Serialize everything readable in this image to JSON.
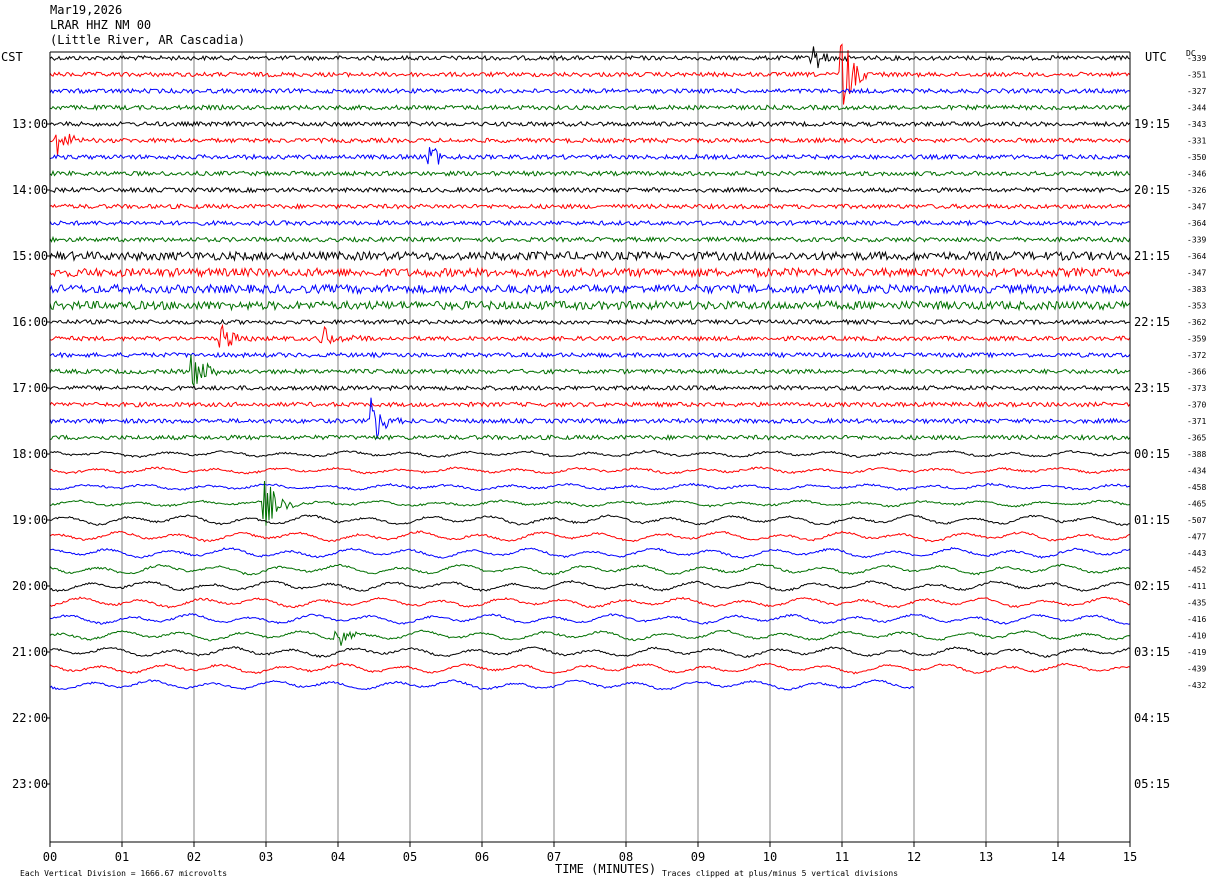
{
  "header": {
    "line1": "Mar19,2026",
    "line2": "LRAR HHZ NM 00",
    "line3": "(Little River, AR Cascadia)"
  },
  "labels": {
    "left_tz": "CST",
    "right_tz": "UTC",
    "dc": "DC",
    "xlabel": "TIME (MINUTES)",
    "footer_left": "Each Vertical Division = 1666.67 microvolts",
    "footer_right": "Traces clipped at plus/minus 5 vertical divisions"
  },
  "chart_data": {
    "type": "line",
    "title": "LRAR HHZ NM 00",
    "xlabel": "TIME (MINUTES)",
    "xlim": [
      0,
      15
    ],
    "x_ticks": [
      "00",
      "01",
      "02",
      "03",
      "04",
      "05",
      "06",
      "07",
      "08",
      "09",
      "10",
      "11",
      "12",
      "13",
      "14",
      "15"
    ],
    "left_hour_labels": [
      "13:00",
      "14:00",
      "15:00",
      "16:00",
      "17:00",
      "18:00",
      "19:00",
      "20:00",
      "21:00",
      "22:00",
      "23:00"
    ],
    "right_hour_labels": [
      "19:15",
      "20:15",
      "21:15",
      "22:15",
      "23:15",
      "00:15",
      "01:15",
      "02:15",
      "03:15",
      "04:15",
      "05:15"
    ],
    "trace_colors": [
      "#000000",
      "#ff0000",
      "#0000ff",
      "#007000"
    ],
    "dc_offsets": [
      -339,
      -351,
      -327,
      -344,
      -343,
      -331,
      -350,
      -346,
      -326,
      -347,
      -364,
      -339,
      -364,
      -347,
      -383,
      -353,
      -362,
      -359,
      -372,
      -366,
      -373,
      -370,
      -371,
      -365,
      -388,
      -434,
      -458,
      -465,
      -507,
      -477,
      -443,
      -452,
      -411,
      -435,
      -416,
      -410,
      -419,
      -439,
      -432
    ],
    "trace_count": 39,
    "last_trace_end_minute": 12,
    "events": [
      {
        "trace": 1,
        "minute": 11.0,
        "amp": 5
      },
      {
        "trace": 0,
        "minute": 10.6,
        "amp": 2
      },
      {
        "trace": 5,
        "minute": 0.1,
        "amp": 2
      },
      {
        "trace": 6,
        "minute": 5.3,
        "amp": 1.5
      },
      {
        "trace": 17,
        "minute": 2.4,
        "amp": 2
      },
      {
        "trace": 17,
        "minute": 3.8,
        "amp": 1.5
      },
      {
        "trace": 19,
        "minute": 2.0,
        "amp": 2.5
      },
      {
        "trace": 22,
        "minute": 4.5,
        "amp": 3
      },
      {
        "trace": 27,
        "minute": 3.0,
        "amp": 3
      },
      {
        "trace": 35,
        "minute": 4.0,
        "amp": 1.2
      }
    ]
  }
}
